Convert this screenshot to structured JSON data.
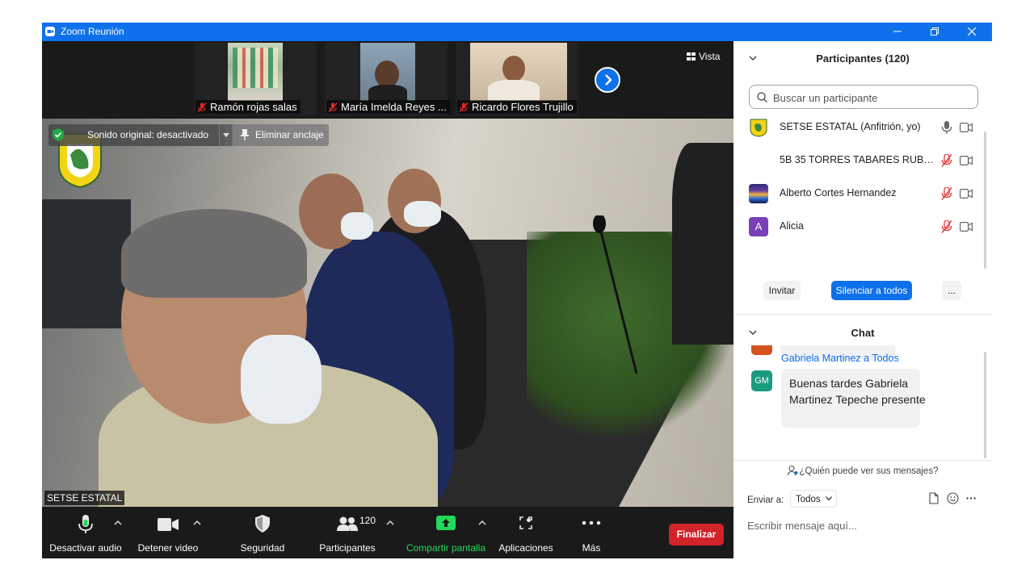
{
  "window": {
    "title": "Zoom Reunión",
    "accent_color": "#0e71eb",
    "controls": [
      "minimize-icon",
      "restore-icon",
      "close-icon"
    ]
  },
  "gallery_strip": {
    "thumbnails": [
      {
        "name": "Ramón rojas salas",
        "muted": true
      },
      {
        "name": "María Imelda Reyes ...",
        "muted": true
      },
      {
        "name": "Ricardo Flores Trujillo",
        "muted": true
      }
    ],
    "next_icon": "chevron-right-icon",
    "view_label": "Vista"
  },
  "main_video": {
    "original_sound_label": "Sonido original: desactivado",
    "unpin_label": "Eliminar anclaje",
    "speaker_name": "SETSE ESTATAL"
  },
  "toolbar": {
    "mute_label": "Desactivar audio",
    "video_label": "Detener video",
    "security_label": "Seguridad",
    "participants_label": "Participantes",
    "participants_count": "120",
    "share_label": "Compartir pantalla",
    "share_color": "#23d959",
    "apps_label": "Aplicaciones",
    "more_label": "Más",
    "end_label": "Finalizar",
    "end_color": "#d1232a"
  },
  "participants_panel": {
    "title": "Participantes (120)",
    "search_placeholder": "Buscar un participante",
    "list": [
      {
        "name": "SETSE ESTATAL (Anfitrión, yo)",
        "mic": "on",
        "avatar": "logo"
      },
      {
        "name": "5B 35 TORRES TABARES RUBEN ...",
        "mic": "muted",
        "avatar": "none"
      },
      {
        "name": "Alberto Cortes Hernandez",
        "mic": "muted",
        "avatar": "photo"
      },
      {
        "name": "Alicia",
        "mic": "muted",
        "avatar": "A"
      }
    ],
    "invite_label": "Invitar",
    "mute_all_label": "Silenciar a todos",
    "more_label": "..."
  },
  "chat_panel": {
    "title": "Chat",
    "message": {
      "sender": "Gabriela Martinez",
      "to_word": "a",
      "recipient": "Todos",
      "initials": "GM",
      "text": "Buenas tardes Gabriela Martinez Tepeche presente"
    },
    "who_can_see": "¿Quién puede ver sus mensajes?",
    "send_to_label": "Enviar a:",
    "send_to_value": "Todos",
    "input_placeholder": "Escribir mensaje aquí..."
  }
}
